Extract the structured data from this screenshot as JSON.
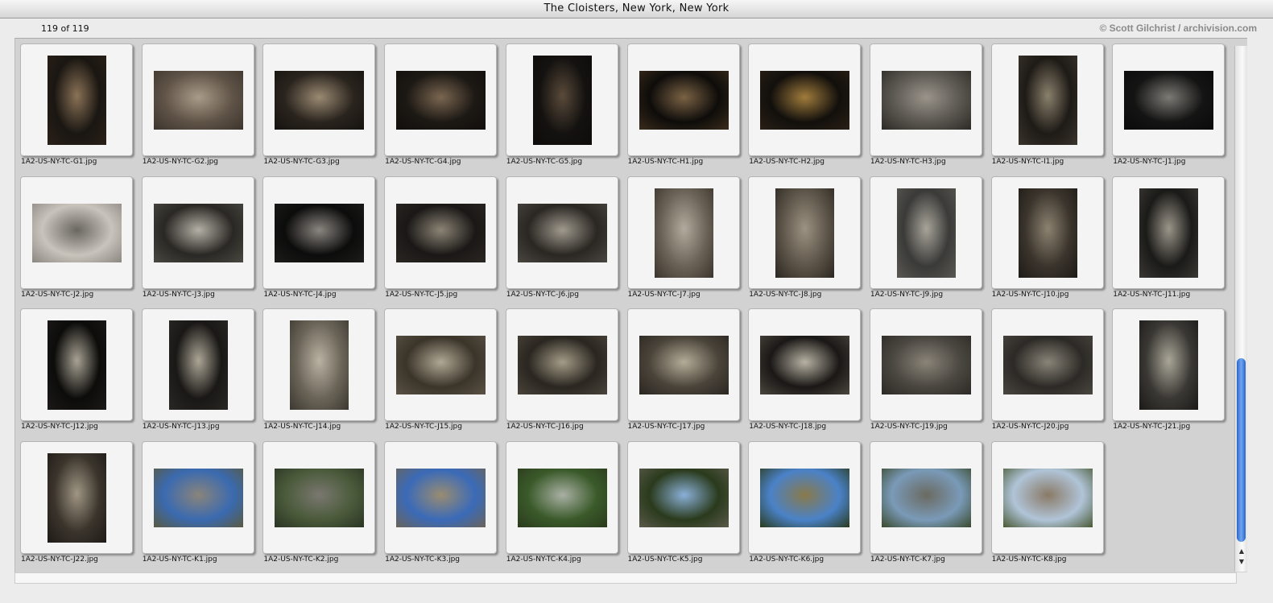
{
  "window": {
    "title": "The Cloisters, New York, New York",
    "count": "119 of 119",
    "credit": "© Scott Gilchrist / archivision.com"
  },
  "thumbnails": [
    {
      "name": "1A2-US-NY-TC-G1.jpg",
      "orientation": "portrait",
      "colors": [
        "#1a1612",
        "#8a7256",
        "#2a2118"
      ]
    },
    {
      "name": "1A2-US-NY-TC-G2.jpg",
      "orientation": "landscape",
      "colors": [
        "#5f5347",
        "#a89b88",
        "#3c342c"
      ]
    },
    {
      "name": "1A2-US-NY-TC-G3.jpg",
      "orientation": "landscape",
      "colors": [
        "#2a241e",
        "#9a8a72",
        "#15120f"
      ]
    },
    {
      "name": "1A2-US-NY-TC-G4.jpg",
      "orientation": "landscape",
      "colors": [
        "#1c1814",
        "#7a6650",
        "#120f0c"
      ]
    },
    {
      "name": "1A2-US-NY-TC-G5.jpg",
      "orientation": "portrait",
      "colors": [
        "#141210",
        "#5a4a3a",
        "#0e0c0a"
      ]
    },
    {
      "name": "1A2-US-NY-TC-H1.jpg",
      "orientation": "landscape",
      "colors": [
        "#0e0c0a",
        "#7a6244",
        "#3a2c1c"
      ]
    },
    {
      "name": "1A2-US-NY-TC-H2.jpg",
      "orientation": "landscape",
      "colors": [
        "#120f0c",
        "#a07c3c",
        "#2a2016"
      ]
    },
    {
      "name": "1A2-US-NY-TC-H3.jpg",
      "orientation": "landscape",
      "colors": [
        "#5a5650",
        "#9a948a",
        "#2c2a26"
      ]
    },
    {
      "name": "1A2-US-NY-TC-I1.jpg",
      "orientation": "portrait",
      "colors": [
        "#1e1a16",
        "#8a806c",
        "#3a342c"
      ]
    },
    {
      "name": "1A2-US-NY-TC-J1.jpg",
      "orientation": "landscape",
      "colors": [
        "#141414",
        "#7c7a74",
        "#0a0a0a"
      ]
    },
    {
      "name": "1A2-US-NY-TC-J2.jpg",
      "orientation": "landscape",
      "colors": [
        "#c8c4bc",
        "#6a6660",
        "#8a8680"
      ]
    },
    {
      "name": "1A2-US-NY-TC-J3.jpg",
      "orientation": "landscape",
      "colors": [
        "#2a2824",
        "#b4b0a6",
        "#4a4842"
      ]
    },
    {
      "name": "1A2-US-NY-TC-J4.jpg",
      "orientation": "landscape",
      "colors": [
        "#0c0c0c",
        "#8a8680",
        "#1c1c1a"
      ]
    },
    {
      "name": "1A2-US-NY-TC-J5.jpg",
      "orientation": "landscape",
      "colors": [
        "#1a1816",
        "#8c8476",
        "#2a2622"
      ]
    },
    {
      "name": "1A2-US-NY-TC-J6.jpg",
      "orientation": "landscape",
      "colors": [
        "#2a2622",
        "#a09a8e",
        "#4a4640"
      ]
    },
    {
      "name": "1A2-US-NY-TC-J7.jpg",
      "orientation": "portrait",
      "colors": [
        "#6a6256",
        "#b2aa9c",
        "#3a342c"
      ]
    },
    {
      "name": "1A2-US-NY-TC-J8.jpg",
      "orientation": "portrait",
      "colors": [
        "#5c5448",
        "#9c9282",
        "#2a2620"
      ]
    },
    {
      "name": "1A2-US-NY-TC-J9.jpg",
      "orientation": "portrait",
      "colors": [
        "#3a3a38",
        "#a8a49a",
        "#5a5852"
      ]
    },
    {
      "name": "1A2-US-NY-TC-J10.jpg",
      "orientation": "portrait",
      "colors": [
        "#3a342c",
        "#8c8270",
        "#1e1a16"
      ]
    },
    {
      "name": "1A2-US-NY-TC-J11.jpg",
      "orientation": "portrait",
      "colors": [
        "#1a1a18",
        "#9c968a",
        "#3a3834"
      ]
    },
    {
      "name": "1A2-US-NY-TC-J12.jpg",
      "orientation": "portrait",
      "colors": [
        "#0c0c0a",
        "#a8a294",
        "#1c1a18"
      ]
    },
    {
      "name": "1A2-US-NY-TC-J13.jpg",
      "orientation": "portrait",
      "colors": [
        "#1a1816",
        "#aca696",
        "#2a2824"
      ]
    },
    {
      "name": "1A2-US-NY-TC-J14.jpg",
      "orientation": "portrait",
      "colors": [
        "#6a6458",
        "#bab2a2",
        "#3c3830"
      ]
    },
    {
      "name": "1A2-US-NY-TC-J15.jpg",
      "orientation": "landscape",
      "colors": [
        "#3a342a",
        "#b0a894",
        "#5a5244"
      ]
    },
    {
      "name": "1A2-US-NY-TC-J16.jpg",
      "orientation": "landscape",
      "colors": [
        "#2a2620",
        "#a49c88",
        "#4a443a"
      ]
    },
    {
      "name": "1A2-US-NY-TC-J17.jpg",
      "orientation": "landscape",
      "colors": [
        "#4a443a",
        "#b4ac98",
        "#2a2620"
      ]
    },
    {
      "name": "1A2-US-NY-TC-J18.jpg",
      "orientation": "landscape",
      "colors": [
        "#1a1816",
        "#b8b2a4",
        "#4a463e"
      ]
    },
    {
      "name": "1A2-US-NY-TC-J19.jpg",
      "orientation": "landscape",
      "colors": [
        "#4a4640",
        "#8a8478",
        "#2c2a26"
      ]
    },
    {
      "name": "1A2-US-NY-TC-J20.jpg",
      "orientation": "landscape",
      "colors": [
        "#2c2a26",
        "#8a8478",
        "#4a4640"
      ]
    },
    {
      "name": "1A2-US-NY-TC-J21.jpg",
      "orientation": "portrait",
      "colors": [
        "#3a3834",
        "#aaa698",
        "#1c1a18"
      ]
    },
    {
      "name": "1A2-US-NY-TC-J22.jpg",
      "orientation": "portrait",
      "colors": [
        "#3a342c",
        "#a09684",
        "#1e1a16"
      ]
    },
    {
      "name": "1A2-US-NY-TC-K1.jpg",
      "orientation": "landscape",
      "colors": [
        "#3a6ab0",
        "#8a847a",
        "#5a5a40"
      ]
    },
    {
      "name": "1A2-US-NY-TC-K2.jpg",
      "orientation": "landscape",
      "colors": [
        "#4a5a3a",
        "#7a7870",
        "#2a3424"
      ]
    },
    {
      "name": "1A2-US-NY-TC-K3.jpg",
      "orientation": "landscape",
      "colors": [
        "#3a6ab8",
        "#9a8c70",
        "#6a6458"
      ]
    },
    {
      "name": "1A2-US-NY-TC-K4.jpg",
      "orientation": "landscape",
      "colors": [
        "#3a5a2a",
        "#aab0a4",
        "#2a3a1c"
      ]
    },
    {
      "name": "1A2-US-NY-TC-K5.jpg",
      "orientation": "landscape",
      "colors": [
        "#2a3a1c",
        "#8ab0d8",
        "#5a5a4a"
      ]
    },
    {
      "name": "1A2-US-NY-TC-K6.jpg",
      "orientation": "landscape",
      "colors": [
        "#4a82c8",
        "#8a7a4a",
        "#2a3a1c"
      ]
    },
    {
      "name": "1A2-US-NY-TC-K7.jpg",
      "orientation": "landscape",
      "colors": [
        "#7a9ab8",
        "#6a6a60",
        "#3a4a2c"
      ]
    },
    {
      "name": "1A2-US-NY-TC-K8.jpg",
      "orientation": "landscape",
      "colors": [
        "#b0c4d8",
        "#8a7a66",
        "#4a5a34"
      ]
    }
  ],
  "scroll_position": 0.62
}
